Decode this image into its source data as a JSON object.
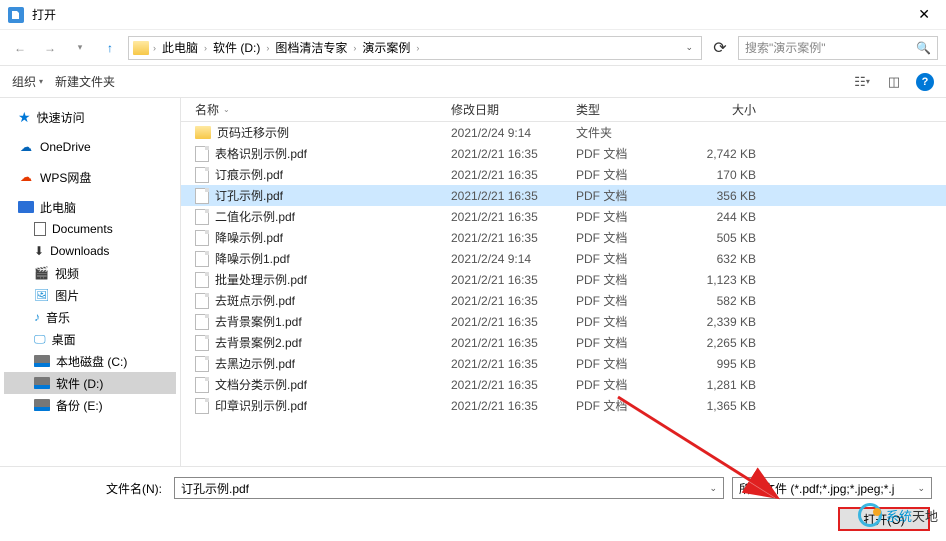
{
  "title": "打开",
  "breadcrumb": [
    "此电脑",
    "软件 (D:)",
    "图档清洁专家",
    "演示案例"
  ],
  "search_placeholder": "搜索\"演示案例\"",
  "toolbar": {
    "organize": "组织",
    "new_folder": "新建文件夹"
  },
  "sidebar": {
    "quick_access": "快速访问",
    "onedrive": "OneDrive",
    "wps": "WPS网盘",
    "this_pc": "此电脑",
    "documents": "Documents",
    "downloads": "Downloads",
    "videos": "视频",
    "pictures": "图片",
    "music": "音乐",
    "desktop": "桌面",
    "disk_c": "本地磁盘 (C:)",
    "disk_d": "软件 (D:)",
    "disk_e": "备份 (E:)"
  },
  "columns": {
    "name": "名称",
    "date": "修改日期",
    "type": "类型",
    "size": "大小"
  },
  "files": [
    {
      "name": "页码迁移示例",
      "date": "2021/2/24 9:14",
      "type": "文件夹",
      "size": "",
      "kind": "folder"
    },
    {
      "name": "表格识别示例.pdf",
      "date": "2021/2/21 16:35",
      "type": "PDF 文档",
      "size": "2,742 KB",
      "kind": "pdf"
    },
    {
      "name": "订痕示例.pdf",
      "date": "2021/2/21 16:35",
      "type": "PDF 文档",
      "size": "170 KB",
      "kind": "pdf"
    },
    {
      "name": "订孔示例.pdf",
      "date": "2021/2/21 16:35",
      "type": "PDF 文档",
      "size": "356 KB",
      "kind": "pdf",
      "selected": true
    },
    {
      "name": "二值化示例.pdf",
      "date": "2021/2/21 16:35",
      "type": "PDF 文档",
      "size": "244 KB",
      "kind": "pdf"
    },
    {
      "name": "降噪示例.pdf",
      "date": "2021/2/21 16:35",
      "type": "PDF 文档",
      "size": "505 KB",
      "kind": "pdf"
    },
    {
      "name": "降噪示例1.pdf",
      "date": "2021/2/24 9:14",
      "type": "PDF 文档",
      "size": "632 KB",
      "kind": "pdf"
    },
    {
      "name": "批量处理示例.pdf",
      "date": "2021/2/21 16:35",
      "type": "PDF 文档",
      "size": "1,123 KB",
      "kind": "pdf"
    },
    {
      "name": "去斑点示例.pdf",
      "date": "2021/2/21 16:35",
      "type": "PDF 文档",
      "size": "582 KB",
      "kind": "pdf"
    },
    {
      "name": "去背景案例1.pdf",
      "date": "2021/2/21 16:35",
      "type": "PDF 文档",
      "size": "2,339 KB",
      "kind": "pdf"
    },
    {
      "name": "去背景案例2.pdf",
      "date": "2021/2/21 16:35",
      "type": "PDF 文档",
      "size": "2,265 KB",
      "kind": "pdf"
    },
    {
      "name": "去黑边示例.pdf",
      "date": "2021/2/21 16:35",
      "type": "PDF 文档",
      "size": "995 KB",
      "kind": "pdf"
    },
    {
      "name": "文档分类示例.pdf",
      "date": "2021/2/21 16:35",
      "type": "PDF 文档",
      "size": "1,281 KB",
      "kind": "pdf"
    },
    {
      "name": "印章识别示例.pdf",
      "date": "2021/2/21 16:35",
      "type": "PDF 文档",
      "size": "1,365 KB",
      "kind": "pdf"
    }
  ],
  "filename_label": "文件名(N):",
  "filename_value": "订孔示例.pdf",
  "filetype": "所有文件 (*.pdf;*.jpg;*.jpeg;*.j",
  "open_button": "打开(O)",
  "watermark": {
    "brand": "系统",
    "suffix": "天地"
  }
}
